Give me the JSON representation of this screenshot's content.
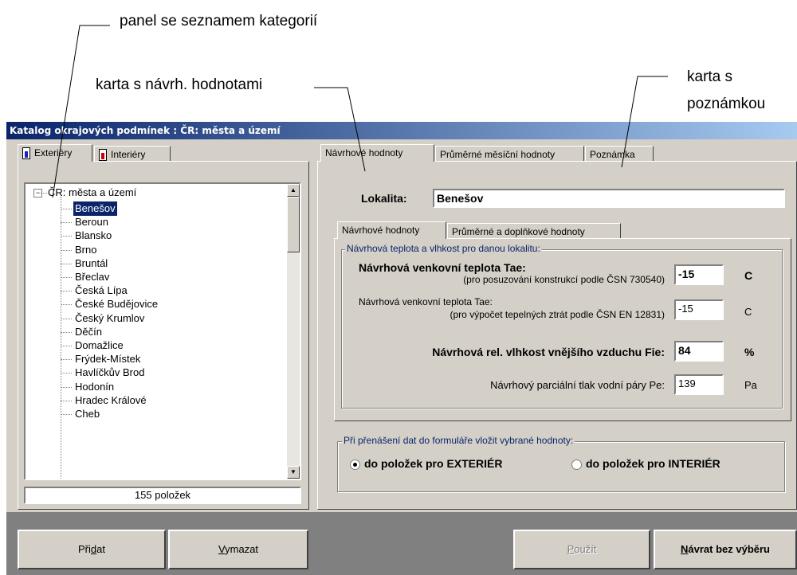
{
  "annotations": {
    "categories_panel": "panel se seznamem kategorií",
    "design_values_card": "karta s návrh. hodnotami",
    "note_card": "karta s poznámkou"
  },
  "window": {
    "title": "Katalog okrajových podmínek : ČR: města a území"
  },
  "left_tabs": [
    "Exteriéry",
    "Interiéry"
  ],
  "tree": {
    "root": "ČR: města a území",
    "selected": "Benešov",
    "items": [
      "Benešov",
      "Beroun",
      "Blansko",
      "Brno",
      "Bruntál",
      "Břeclav",
      "Česká Lípa",
      "České Budějovice",
      "Český Krumlov",
      "Děčín",
      "Domažlice",
      "Frýdek-Místek",
      "Havlíčkův Brod",
      "Hodonín",
      "Hradec Králové",
      "Cheb"
    ]
  },
  "count_label": "155 položek",
  "right_tabs": [
    "Návrhové hodnoty",
    "Průměrné měsíční hodnoty",
    "Poznámka"
  ],
  "locality": {
    "label": "Lokalita:",
    "value": "Benešov"
  },
  "inner_tabs": [
    "Návrhové hodnoty",
    "Průměrné a doplňkové hodnoty"
  ],
  "design_group": {
    "title": "Návrhová teplota a vlhkost pro danou lokalitu:",
    "rows": [
      {
        "label": "Návrhová venkovní teplota Tae:",
        "sub": "(pro posuzování konstrukcí podle ČSN 730540)",
        "value": "-15",
        "unit": "C"
      },
      {
        "label": "Návrhová venkovní teplota Tae:",
        "sub": "(pro výpočet tepelných ztrát podle ČSN EN 12831)",
        "value": "-15",
        "unit": "C"
      },
      {
        "label": "Návrhová rel. vlhkost vnějšího vzduchu Fie:",
        "value": "84",
        "unit": "%"
      },
      {
        "label": "Návrhový parciální tlak vodní páry Pe:",
        "value": "139",
        "unit": "Pa"
      }
    ]
  },
  "transfer_group": {
    "title": "Při přenášení dat do formuláře vložit vybrané hodnoty:",
    "option_exterior": "do položek pro EXTERIÉR",
    "option_interior": "do položek pro INTERIÉR",
    "selected": "exterior"
  },
  "buttons": {
    "add_pre": "Při",
    "add_key": "d",
    "add_post": "at",
    "delete_key": "V",
    "delete_post": "ymazat",
    "use_key": "P",
    "use_post": "oužít",
    "back_key": "N",
    "back_post": "ávrat bez výběru"
  }
}
